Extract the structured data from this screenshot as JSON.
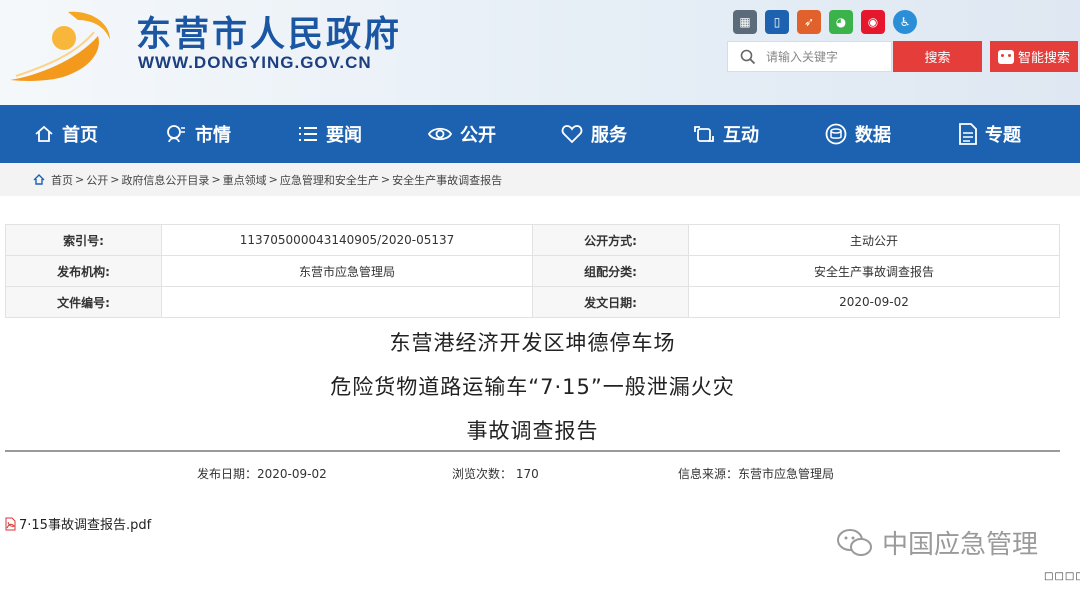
{
  "header": {
    "site_title": "东营市人民政府",
    "site_url": "WWW.DONGYING.GOV.CN",
    "search_placeholder": "请输入关键字",
    "search_label": "搜索",
    "smart_search_label": "智能搜索",
    "share_icons": [
      "barcode-icon",
      "phone-icon",
      "app-icon",
      "wechat-icon",
      "weibo-icon",
      "accessibility-icon"
    ]
  },
  "nav": [
    {
      "label": "首页",
      "icon": "home-icon"
    },
    {
      "label": "市情",
      "icon": "city-info-icon"
    },
    {
      "label": "要闻",
      "icon": "news-list-icon"
    },
    {
      "label": "公开",
      "icon": "eye-icon"
    },
    {
      "label": "服务",
      "icon": "heart-icon"
    },
    {
      "label": "互动",
      "icon": "interaction-icon"
    },
    {
      "label": "数据",
      "icon": "data-icon"
    },
    {
      "label": "专题",
      "icon": "document-icon"
    }
  ],
  "breadcrumb": [
    "首页",
    "公开",
    "政府信息公开目录",
    "重点领域",
    "应急管理和安全生产",
    "安全生产事故调查报告"
  ],
  "meta": {
    "index_label": "索引号:",
    "index_value": "113705000043140905/2020-05137",
    "open_mode_label": "公开方式:",
    "open_mode_value": "主动公开",
    "issuer_label": "发布机构:",
    "issuer_value": "东营市应急管理局",
    "category_label": "组配分类:",
    "category_value": "安全生产事故调查报告",
    "doc_no_label": "文件编号:",
    "doc_no_value": "",
    "issue_date_label": "发文日期:",
    "issue_date_value": "2020-09-02"
  },
  "article": {
    "title_line1": "东营港经济开发区坤德停车场",
    "title_line2": "危险货物道路运输车“7·15”一般泄漏火灾",
    "title_line3": "事故调查报告",
    "publish_date": "发布日期：2020-09-02",
    "views": "浏览次数： 170",
    "source": "信息来源：东营市应急管理局",
    "attachment": "7·15事故调查报告.pdf"
  },
  "watermark": "中国应急管理",
  "corner_text": "□□□□",
  "colors": {
    "brand_blue": "#1d62b1",
    "title_blue": "#1b56a3",
    "accent_red": "#e43d3a",
    "logo_orange": "#f39a1c"
  }
}
